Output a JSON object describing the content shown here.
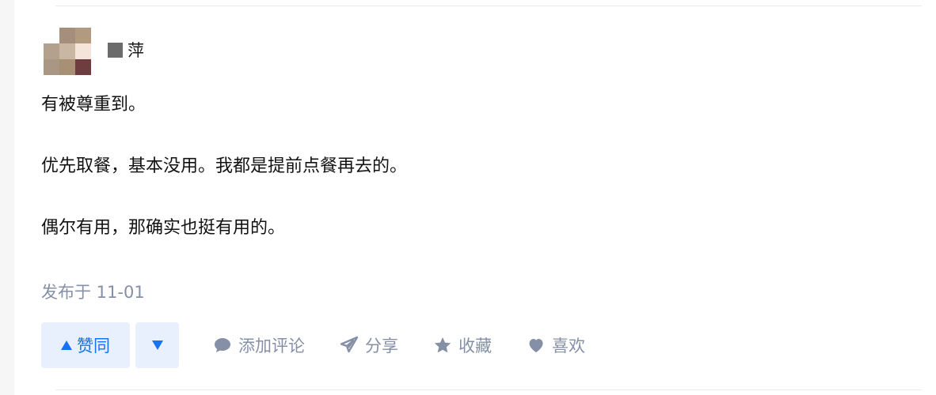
{
  "author": {
    "name_suffix": "萍",
    "avatar_colors": [
      "#ffffff",
      "#a58e7b",
      "#b29a80",
      "#b3a08d",
      "#c9b6a3",
      "#f4e4d9",
      "#a99683",
      "#a89077",
      "#6f3d3f"
    ]
  },
  "answer": {
    "paragraphs": [
      "有被尊重到。",
      "优先取餐，基本没用。我都是提前点餐再去的。",
      "偶尔有用，那确实也挺有用的。"
    ],
    "published": "发布于 11-01"
  },
  "actions": {
    "upvote_label": "赞同",
    "comment_label": "添加评论",
    "share_label": "分享",
    "favorite_label": "收藏",
    "like_label": "喜欢"
  },
  "colors": {
    "accent": "#1772f6",
    "accent_bg": "#e8f0fe",
    "muted": "#8590a6"
  }
}
